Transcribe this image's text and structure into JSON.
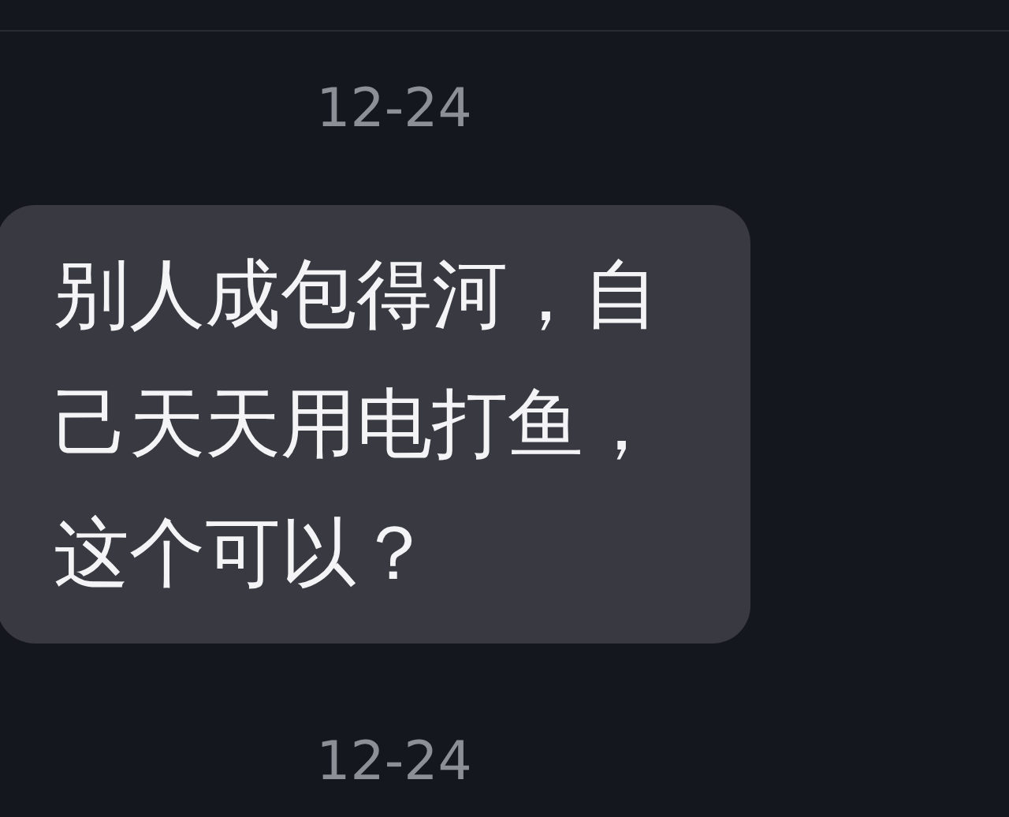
{
  "messages": [
    {
      "kind": "date",
      "text": "12-24"
    },
    {
      "kind": "bubble",
      "text": "别人成包得河，自己天天用电打鱼，这个可以？"
    },
    {
      "kind": "date",
      "text": "12-24"
    }
  ]
}
